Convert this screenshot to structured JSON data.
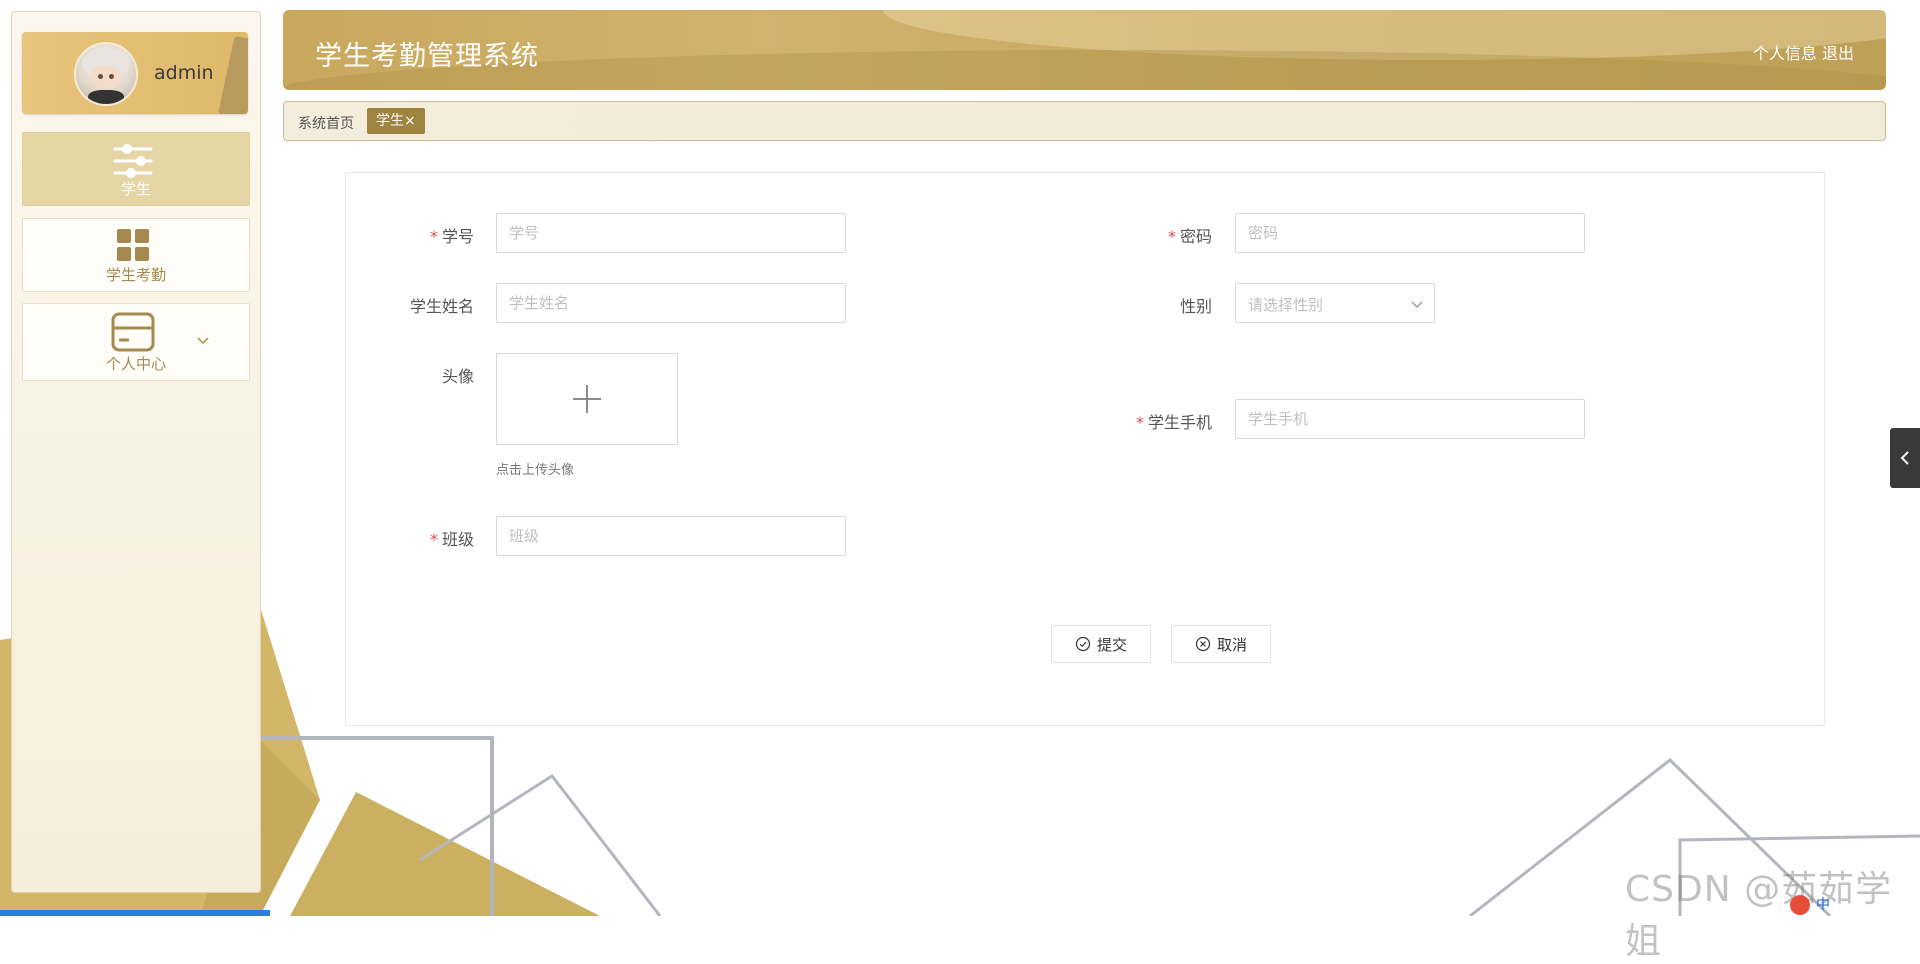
{
  "app": {
    "title": "学生考勤管理系统"
  },
  "header": {
    "profile_link": "个人信息",
    "logout_link": "退出"
  },
  "user": {
    "name": "admin"
  },
  "sidebar": {
    "items": [
      {
        "label": "学生",
        "icon": "sliders-icon",
        "active": true
      },
      {
        "label": "学生考勤",
        "icon": "grid-icon",
        "active": false
      },
      {
        "label": "个人中心",
        "icon": "card-icon",
        "active": false,
        "expandable": true
      }
    ]
  },
  "breadcrumb": {
    "home": "系统首页",
    "active_tag": "学生",
    "close_glyph": "×"
  },
  "form": {
    "student_id": {
      "label": "学号",
      "placeholder": "学号",
      "required": true
    },
    "password": {
      "label": "密码",
      "placeholder": "密码",
      "required": true
    },
    "student_name": {
      "label": "学生姓名",
      "placeholder": "学生姓名",
      "required": false
    },
    "gender": {
      "label": "性别",
      "placeholder": "请选择性别",
      "required": false
    },
    "avatar": {
      "label": "头像",
      "hint": "点击上传头像"
    },
    "phone": {
      "label": "学生手机",
      "placeholder": "学生手机",
      "required": true
    },
    "class": {
      "label": "班级",
      "placeholder": "班级",
      "required": true
    },
    "required_mark": "*"
  },
  "buttons": {
    "submit": "提交",
    "cancel": "取消"
  },
  "watermark": "CSDN @茹茹学姐",
  "tray": {
    "ime": "中"
  },
  "colors": {
    "accent": "#9f8440",
    "header": "#c8a85c",
    "sidebar_active": "#e6d6a6",
    "required": "#e04b4b"
  }
}
